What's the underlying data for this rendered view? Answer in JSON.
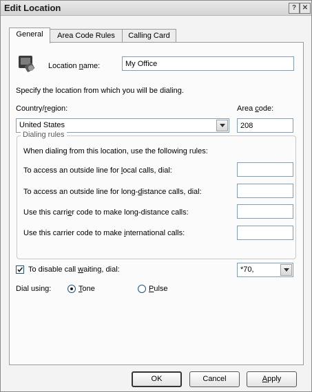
{
  "window": {
    "title": "Edit Location",
    "help_glyph": "?",
    "close_glyph": "✕"
  },
  "tabs": [
    {
      "label": "General",
      "active": true
    },
    {
      "label": "Area Code Rules",
      "active": false
    },
    {
      "label": "Calling Card",
      "active": false
    }
  ],
  "general": {
    "location_name": {
      "label_pre": "Location ",
      "label_u": "n",
      "label_post": "ame:",
      "value": "My Office"
    },
    "specify_text": "Specify the location from which you will be dialing.",
    "country": {
      "label_pre": "Country/",
      "label_u": "r",
      "label_post": "egion:",
      "value": "United States"
    },
    "area_code": {
      "label_pre": "Area ",
      "label_u": "c",
      "label_post": "ode:",
      "value": "208"
    },
    "dialing_rules": {
      "title": "Dialing rules",
      "intro": "When dialing from this location, use the following rules:",
      "rules": [
        {
          "pre": "To access an outside line for ",
          "u": "l",
          "post": "ocal calls, dial:",
          "value": ""
        },
        {
          "pre": "To access an outside line for long-",
          "u": "d",
          "post": "istance calls, dial:",
          "value": ""
        },
        {
          "pre": "Use this carri",
          "u": "e",
          "post": "r code to make long-distance calls:",
          "value": ""
        },
        {
          "pre": "Use this carrier code to make ",
          "u": "i",
          "post": "nternational calls:",
          "value": ""
        }
      ]
    },
    "call_waiting": {
      "checked": true,
      "label_pre": "To disable call ",
      "label_u": "w",
      "label_post": "aiting, dial:",
      "value": "*70,"
    },
    "dial_using": {
      "label": "Dial using:",
      "options": [
        {
          "u": "T",
          "post": "one",
          "selected": true
        },
        {
          "u": "P",
          "post": "ulse",
          "selected": false
        }
      ]
    }
  },
  "buttons": {
    "ok": "OK",
    "cancel": "Cancel",
    "apply_u": "A",
    "apply_post": "pply"
  }
}
